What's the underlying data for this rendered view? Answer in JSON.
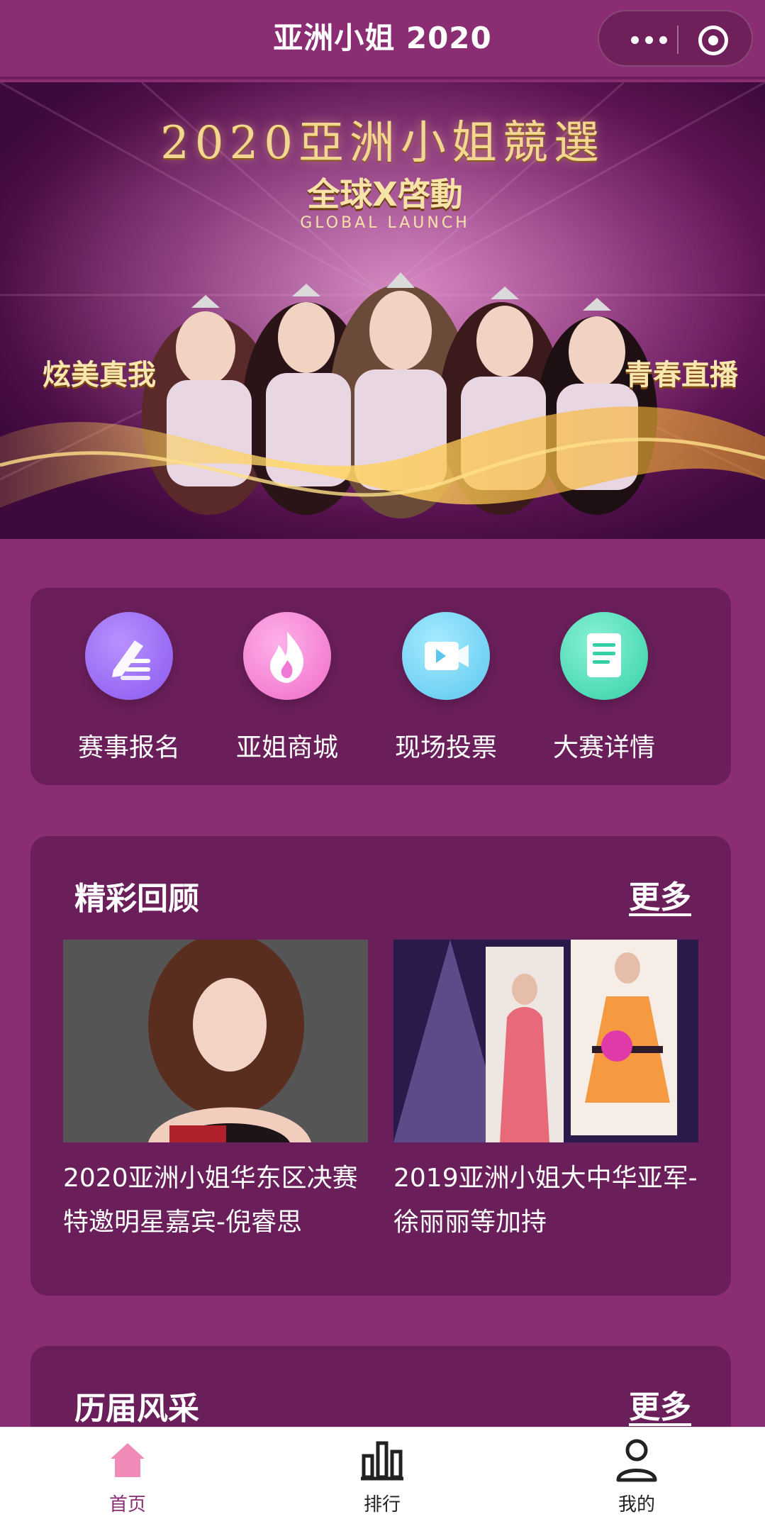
{
  "navbar": {
    "title": "亚洲小姐 2020",
    "more_icon": "more-dots-icon",
    "close_icon": "close-ring-icon"
  },
  "banner": {
    "title": "2020亞洲小姐競選",
    "subtitle": "全球X啓動",
    "subtitle_en": "GLOBAL LAUNCH",
    "left_slogan": "炫美真我",
    "right_slogan": "青春直播"
  },
  "quick_menu": {
    "items": [
      {
        "label": "赛事报名",
        "icon": "register-edit-icon",
        "color": "#9b6cf5"
      },
      {
        "label": "亚姐商城",
        "icon": "flame-icon",
        "color": "#f07ad3"
      },
      {
        "label": "现场投票",
        "icon": "video-camera-icon",
        "color": "#6fd3f2"
      },
      {
        "label": "大赛详情",
        "icon": "document-icon",
        "color": "#45d9b5"
      }
    ]
  },
  "highlights": {
    "title": "精彩回顾",
    "more": "更多",
    "articles": [
      {
        "title": "2020亚洲小姐华东区决赛特邀明星嘉宾-倪睿思"
      },
      {
        "title": "2019亚洲小姐大中华亚军-徐丽丽等加持"
      }
    ]
  },
  "past": {
    "title": "历届风采",
    "more": "更多"
  },
  "tabbar": {
    "items": [
      {
        "label": "首页",
        "icon": "home-icon",
        "active": true
      },
      {
        "label": "排行",
        "icon": "ranking-chart-icon",
        "active": false
      },
      {
        "label": "我的",
        "icon": "user-icon",
        "active": false
      }
    ],
    "active_color": "#8a2d73",
    "inactive_color": "#222222",
    "active_icon_color": "#f08ab8"
  }
}
